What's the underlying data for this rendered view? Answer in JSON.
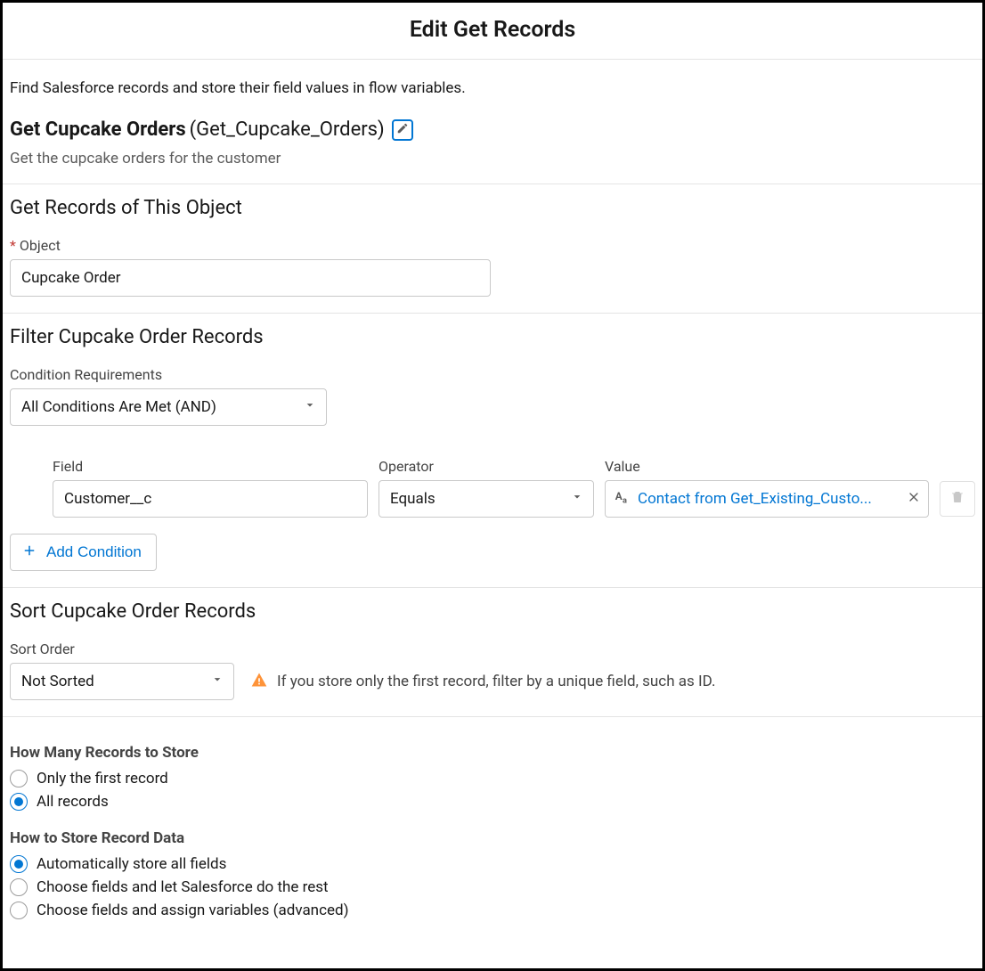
{
  "modal": {
    "title": "Edit Get Records"
  },
  "intro": {
    "description": "Find Salesforce records and store their field values in flow variables.",
    "element_name": "Get Cupcake Orders",
    "element_api": "(Get_Cupcake_Orders)",
    "element_sub": "Get the cupcake orders for the customer"
  },
  "object_section": {
    "heading": "Get Records of This Object",
    "object_label": "Object",
    "object_value": "Cupcake Order"
  },
  "filter_section": {
    "heading": "Filter Cupcake Order Records",
    "cond_req_label": "Condition Requirements",
    "cond_req_value": "All Conditions Are Met (AND)",
    "field_label": "Field",
    "field_value": "Customer__c",
    "operator_label": "Operator",
    "operator_value": "Equals",
    "value_label": "Value",
    "value_text": "Contact from Get_Existing_Custo...",
    "add_condition": "Add Condition"
  },
  "sort_section": {
    "heading": "Sort Cupcake Order Records",
    "sort_order_label": "Sort Order",
    "sort_order_value": "Not Sorted",
    "warning_text": "If you store only the first record, filter by a unique field, such as ID."
  },
  "store_section": {
    "how_many_heading": "How Many Records to Store",
    "how_many_options": [
      "Only the first record",
      "All records"
    ],
    "how_many_selected": 1,
    "how_store_heading": "How to Store Record Data",
    "how_store_options": [
      "Automatically store all fields",
      "Choose fields and let Salesforce do the rest",
      "Choose fields and assign variables (advanced)"
    ],
    "how_store_selected": 0
  }
}
